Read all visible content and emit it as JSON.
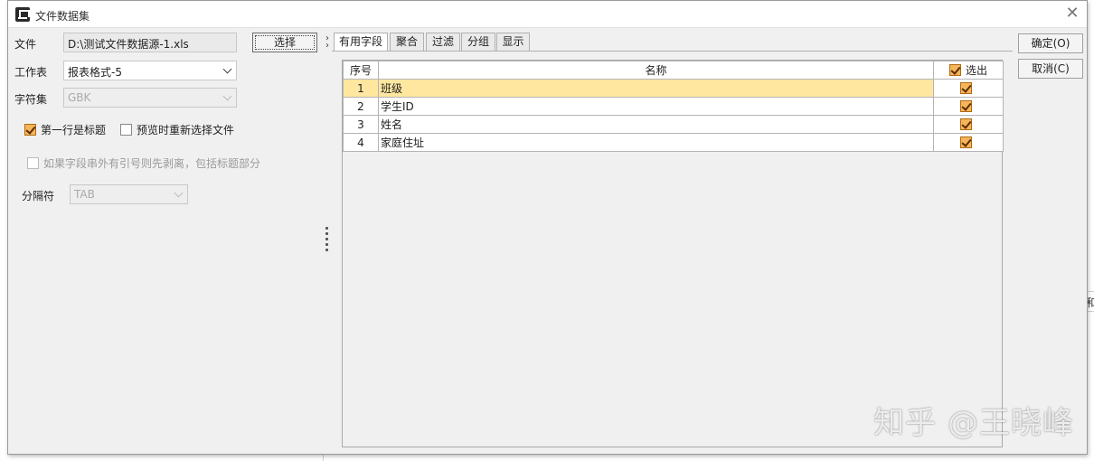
{
  "dialog": {
    "title": "文件数据集",
    "close_icon": "close-icon"
  },
  "form": {
    "file_label": "文件",
    "file_value": "D:\\测试文件数据源-1.xls",
    "choose_button": "选择",
    "sheet_label": "工作表",
    "sheet_value": "报表格式-5",
    "charset_label": "字符集",
    "charset_value": "GBK",
    "first_row_title": {
      "label": "第一行是标题",
      "checked": true
    },
    "reselect_on_preview": {
      "label": "预览时重新选择文件",
      "checked": false
    },
    "strip_quotes": {
      "label": "如果字段串外有引号则先剥离，包括标题部分",
      "checked": false
    },
    "separator_label": "分隔符",
    "separator_value": "TAB"
  },
  "tabs": [
    {
      "label": "有用字段",
      "active": true
    },
    {
      "label": "聚合",
      "active": false
    },
    {
      "label": "过滤",
      "active": false
    },
    {
      "label": "分组",
      "active": false
    },
    {
      "label": "显示",
      "active": false
    }
  ],
  "table": {
    "headers": {
      "index": "序号",
      "name": "名称",
      "select": "选出"
    },
    "rows": [
      {
        "index": "1",
        "name": "班级",
        "selected": true
      },
      {
        "index": "2",
        "name": "学生ID",
        "selected": true
      },
      {
        "index": "3",
        "name": "姓名",
        "selected": true
      },
      {
        "index": "4",
        "name": "家庭住址",
        "selected": true
      }
    ]
  },
  "buttons": {
    "ok": "确定(O)",
    "cancel": "取消(C)"
  },
  "background": {
    "peek_text": "和"
  },
  "watermark": "知乎 @王晓峰",
  "colors": {
    "row_highlight": "#ffe7a0",
    "checkbox_fill": "#f6b55a"
  }
}
